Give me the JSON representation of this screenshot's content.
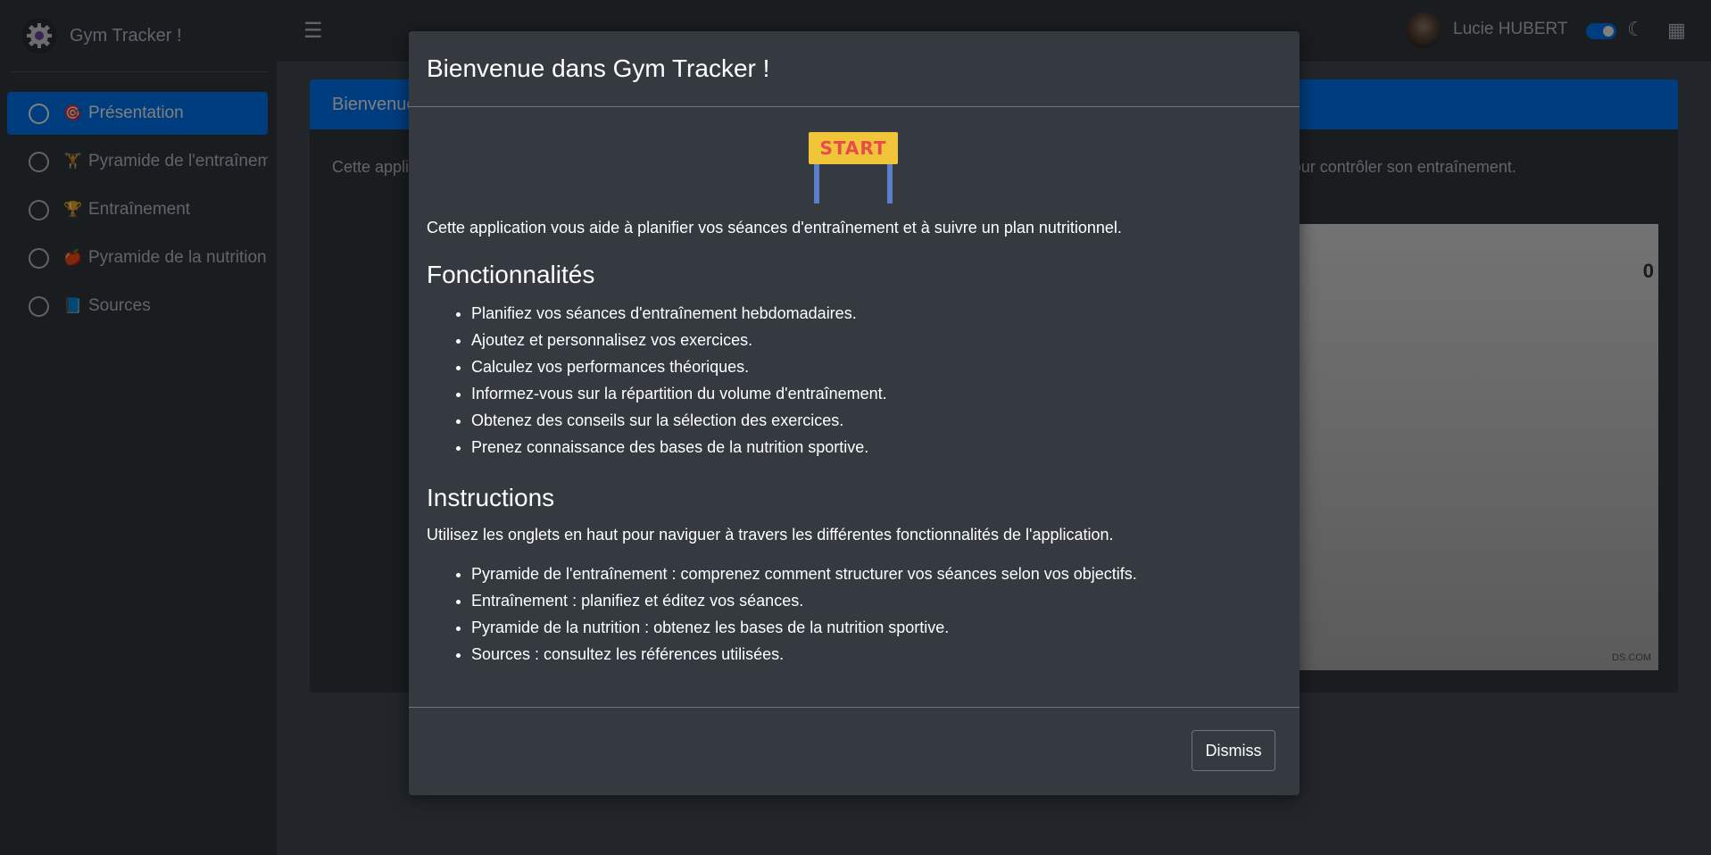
{
  "app": {
    "title": "Gym Tracker !"
  },
  "sidebar": {
    "items": [
      {
        "emoji": "🎯",
        "label": "Présentation",
        "active": true
      },
      {
        "emoji": "🏋",
        "label": "Pyramide de l'entraînement"
      },
      {
        "emoji": "🏆",
        "label": "Entraînement"
      },
      {
        "emoji": "🍎",
        "label": "Pyramide de la nutrition"
      },
      {
        "emoji": "📘",
        "label": "Sources"
      }
    ]
  },
  "header": {
    "menu_icon": "☰",
    "username": "Lucie HUBERT",
    "moon_icon": "☾",
    "apps_icon": "▦"
  },
  "background": {
    "card_title": "Bienvenue",
    "card_text": "Cette application vous aide à planifier vos séances d'entraînement et vous informe sur les différents paramètres à prendre en compte pour contrôler son entraînement.",
    "image_text_top": "0",
    "image_text_bottom": "DS.COM"
  },
  "modal": {
    "title": "Bienvenue dans Gym Tracker !",
    "sign_text": "START",
    "intro": "Cette application vous aide à planifier vos séances d'entraînement et à suivre un plan nutritionnel.",
    "features_title": "Fonctionnalités",
    "features": [
      "Planifiez vos séances d'entraînement hebdomadaires.",
      "Ajoutez et personnalisez vos exercices.",
      "Calculez vos performances théoriques.",
      "Informez-vous sur la répartition du volume d'entraînement.",
      "Obtenez des conseils sur la sélection des exercices.",
      "Prenez connaissance des bases de la nutrition sportive."
    ],
    "instructions_title": "Instructions",
    "instructions_text": "Utilisez les onglets en haut pour naviguer à travers les différentes fonctionnalités de l'application.",
    "instructions": [
      "Pyramide de l'entraînement : comprenez comment structurer vos séances selon vos objectifs.",
      "Entraînement : planifiez et éditez vos séances.",
      "Pyramide de la nutrition : obtenez les bases de la nutrition sportive.",
      "Sources : consultez les références utilisées."
    ],
    "dismiss_label": "Dismiss"
  }
}
